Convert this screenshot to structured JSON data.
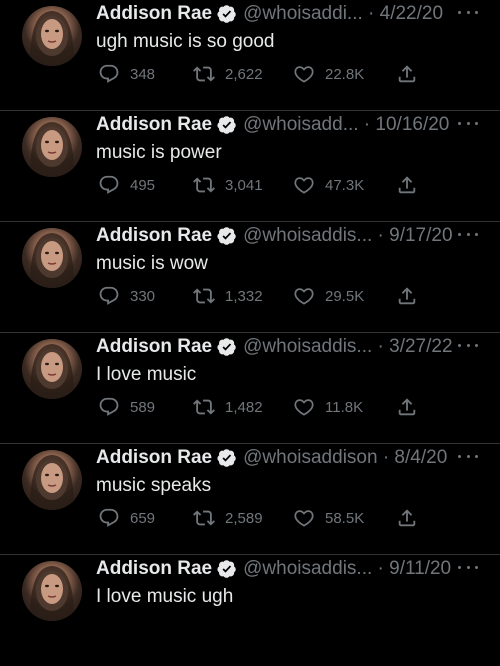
{
  "colors": {
    "background": "#000000",
    "text_primary": "#e7e9ea",
    "text_secondary": "#71767b",
    "verified_badge": "#e7e9ea",
    "divider": "#2f3336"
  },
  "icons": {
    "reply": "speech-bubble-icon",
    "retweet": "retweet-icon",
    "like": "heart-icon",
    "share": "share-upload-icon",
    "verified": "verified-badge-icon",
    "more": "more-dots-icon"
  },
  "tweets": [
    {
      "name": "Addison Rae",
      "handle_date": "@whoisaddi... · 4/22/20",
      "text": "ugh music is so good",
      "replies": "348",
      "retweets": "2,622",
      "likes": "22.8K"
    },
    {
      "name": "Addison Rae",
      "handle_date": "@whoisadd... · 10/16/20",
      "text": "music is power",
      "replies": "495",
      "retweets": "3,041",
      "likes": "47.3K"
    },
    {
      "name": "Addison Rae",
      "handle_date": "@whoisaddis... · 9/17/20",
      "text": "music is wow",
      "replies": "330",
      "retweets": "1,332",
      "likes": "29.5K"
    },
    {
      "name": "Addison Rae",
      "handle_date": "@whoisaddis... · 3/27/22",
      "text": "I love music",
      "replies": "589",
      "retweets": "1,482",
      "likes": "11.8K"
    },
    {
      "name": "Addison Rae",
      "handle_date": "@whoisaddison · 8/4/20",
      "text": "music speaks",
      "replies": "659",
      "retweets": "2,589",
      "likes": "58.5K"
    },
    {
      "name": "Addison Rae",
      "handle_date": "@whoisaddis... · 9/11/20",
      "text": "I love music ugh",
      "replies": "",
      "retweets": "",
      "likes": ""
    }
  ]
}
